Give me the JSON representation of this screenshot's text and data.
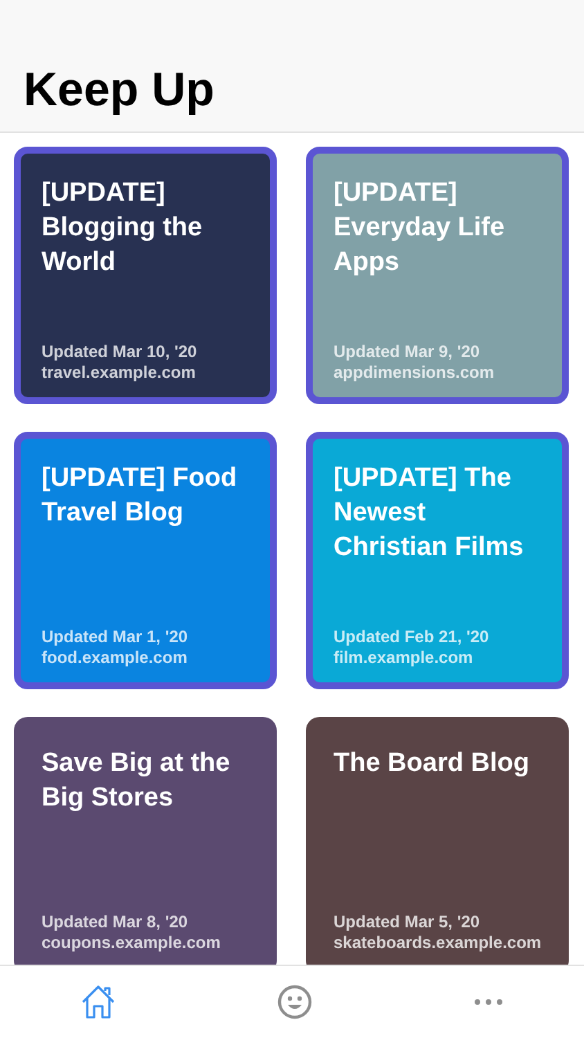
{
  "header": {
    "title": "Keep Up"
  },
  "cards": [
    {
      "title": "[UPDATE] Blogging the World",
      "updated": "Updated Mar 10, '20",
      "site": "travel.example.com",
      "highlighted": true,
      "color": "#283152"
    },
    {
      "title": "[UPDATE] Everyday Life Apps",
      "updated": "Updated Mar 9, '20",
      "site": "appdimensions.com",
      "highlighted": true,
      "color": "#81a1a7"
    },
    {
      "title": "[UPDATE] Food Travel Blog",
      "updated": "Updated Mar 1, '20",
      "site": "food.example.com",
      "highlighted": true,
      "color": "#0a84e0"
    },
    {
      "title": "[UPDATE] The Newest Christian Films",
      "updated": "Updated Feb 21, '20",
      "site": "film.example.com",
      "highlighted": true,
      "color": "#0aa9d6"
    },
    {
      "title": "Save Big at the Big Stores",
      "updated": "Updated Mar 8, '20",
      "site": "coupons.example.com",
      "highlighted": false,
      "color": "#5b4a70"
    },
    {
      "title": "The Board Blog",
      "updated": "Updated Mar 5, '20",
      "site": "skateboards.example.com",
      "highlighted": false,
      "color": "#5a4446"
    }
  ],
  "tabs": [
    {
      "kind": "home",
      "selected": true
    },
    {
      "kind": "smiley",
      "selected": false
    },
    {
      "kind": "more",
      "selected": false
    }
  ]
}
